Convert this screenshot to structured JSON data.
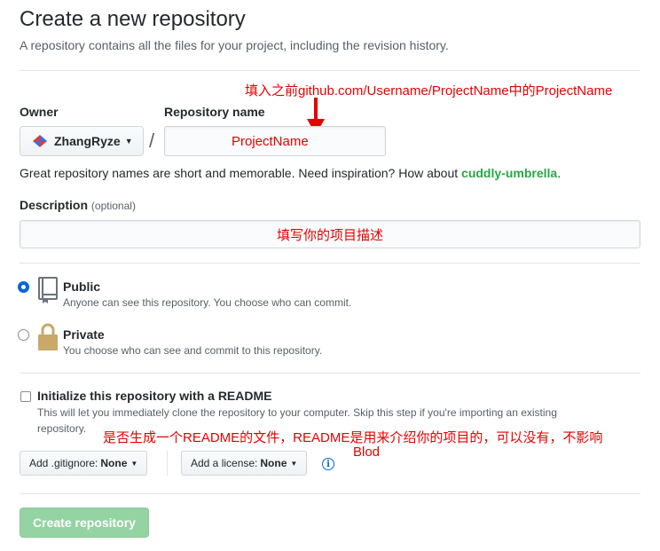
{
  "header": {
    "title": "Create a new repository",
    "subtitle": "A repository contains all the files for your project, including the revision history."
  },
  "annotations": {
    "repo_name_note": "填入之前github.com/Username/ProjectName中的ProjectName",
    "description_note": "填写你的项目描述",
    "readme_note_line1": "是否生成一个README的文件，README是用来介绍你的项目的，可以没有，不影响",
    "readme_note_line2": "Blod",
    "arrow_color": "#e60000"
  },
  "owner": {
    "label": "Owner",
    "value": "ZhangRyze",
    "slash": "/"
  },
  "repo_name": {
    "label": "Repository name",
    "value": "ProjectName"
  },
  "hint": {
    "text": "Great repository names are short and memorable. Need inspiration? How about",
    "suggestion": "cuddly-umbrella",
    "end": "."
  },
  "description": {
    "label": "Description",
    "optional": "(optional)",
    "value": "填写你的项目描述"
  },
  "visibility": {
    "public_label": "Public",
    "public_desc": "Anyone can see this repository. You choose who can commit.",
    "private_label": "Private",
    "private_desc": "You choose who can see and commit to this repository.",
    "selected": "Public"
  },
  "readme": {
    "label": "Initialize this repository with a README",
    "desc_line1": "This will let you immediately clone the repository to your computer. Skip this step if you're importing an existing",
    "desc_line2": "repository.",
    "checked": false
  },
  "gitignore": {
    "prefix": "Add .gitignore:",
    "value": "None"
  },
  "license": {
    "prefix": "Add a license:",
    "value": "None"
  },
  "info_icon_glyph": "i",
  "submit": {
    "label": "Create repository"
  },
  "colors": {
    "accent_blue": "#0366d6",
    "create_button": "#94d3a2",
    "annotation_red": "#e60000",
    "suggestion_green": "#28a745"
  }
}
